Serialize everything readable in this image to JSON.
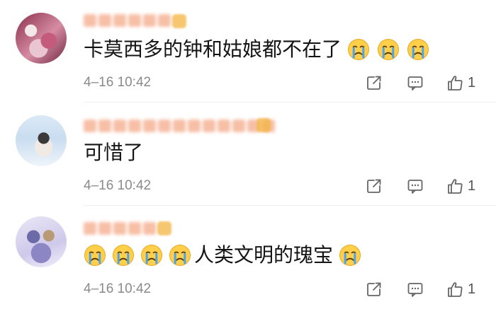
{
  "comments": [
    {
      "text_parts": [
        "卡莫西多的钟和姑娘都不在了"
      ],
      "emoji_after": 3,
      "emoji_before": 0,
      "timestamp": "4–16 10:42",
      "likes": "1",
      "emoji_name": "crying-emoji"
    },
    {
      "text_parts": [
        "可惜了"
      ],
      "emoji_after": 0,
      "emoji_before": 0,
      "timestamp": "4–16 10:42",
      "likes": "1",
      "emoji_name": "crying-emoji"
    },
    {
      "text_parts": [
        "人类文明的瑰宝"
      ],
      "emoji_after": 1,
      "emoji_before": 4,
      "timestamp": "4–16 10:42",
      "likes": "1",
      "emoji_name": "crying-emoji"
    }
  ],
  "icons": {
    "share": "share-icon",
    "reply": "comment-icon",
    "like": "thumbs-up-icon"
  },
  "colors": {
    "text": "#141414",
    "meta": "#8a8a8a",
    "divider": "#eeeeee",
    "emoji_face": "#ffcf4a",
    "emoji_tear": "#4aa3f0"
  }
}
